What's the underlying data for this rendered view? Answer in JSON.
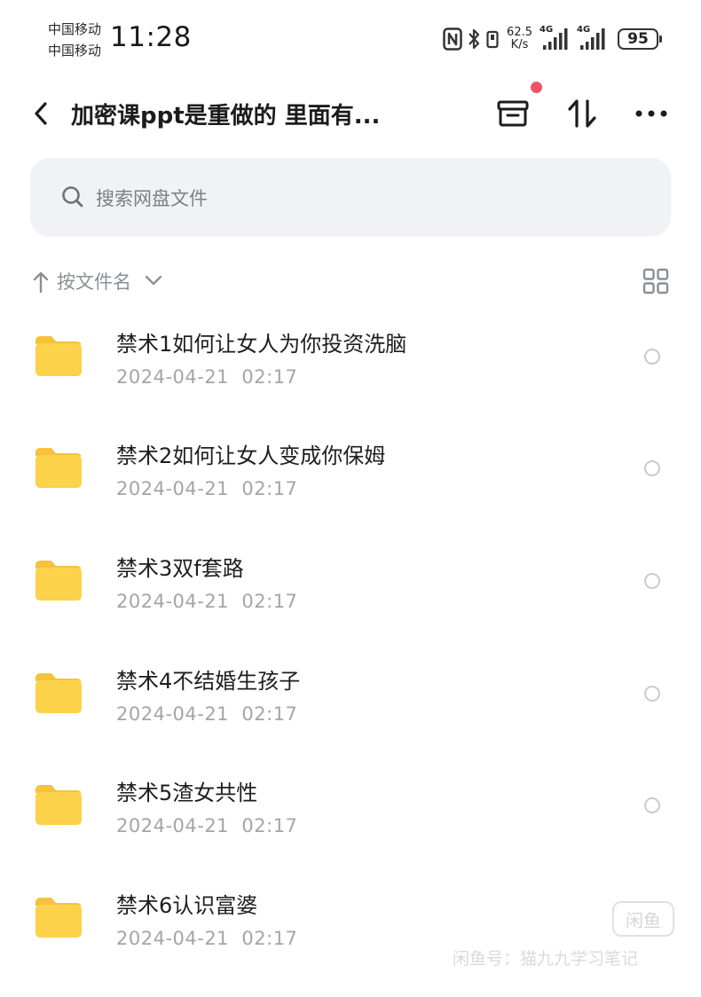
{
  "status_bar": {
    "carrier_1": "中国移动",
    "carrier_2": "中国移动",
    "time": "11:28",
    "net_speed_value": "62.5",
    "net_speed_unit": "K/s",
    "signal_1_label": "4G",
    "signal_2_label": "4G",
    "battery": "95",
    "icons": [
      "nfc-icon",
      "bluetooth-icon",
      "vibrate-icon",
      "signal-icon",
      "battery-icon"
    ]
  },
  "header": {
    "title": "加密课ppt是重做的 里面有...",
    "icons": [
      "back-icon",
      "transfer-list-icon",
      "sort-swap-icon",
      "more-icon"
    ],
    "notification_dot_color": "#f2516b"
  },
  "search": {
    "placeholder": "搜索网盘文件"
  },
  "sort": {
    "label": "按文件名"
  },
  "files": [
    {
      "name": "禁术1如何让女人为你投资洗脑",
      "date": "2024-04-21  02:17"
    },
    {
      "name": "禁术2如何让女人变成你保姆",
      "date": "2024-04-21  02:17"
    },
    {
      "name": "禁术3双f套路",
      "date": "2024-04-21  02:17"
    },
    {
      "name": "禁术4不结婚生孩子",
      "date": "2024-04-21  02:17"
    },
    {
      "name": "禁术5渣女共性",
      "date": "2024-04-21  02:17"
    },
    {
      "name": "禁术6认识富婆",
      "date": "2024-04-21  02:17"
    }
  ],
  "watermark": {
    "logo_text": "闲鱼",
    "text": "闲鱼号：猫九九学习笔记"
  },
  "colors": {
    "folder": "#fcd24a",
    "folder_tab": "#f6c23a",
    "accent_dot": "#f2516b",
    "muted_text": "#a3a5a9"
  }
}
